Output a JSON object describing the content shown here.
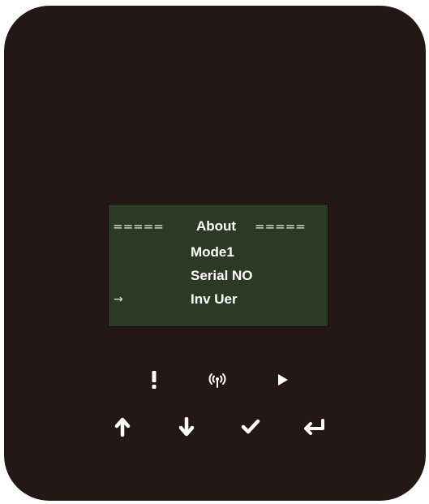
{
  "lcd": {
    "header": {
      "left_rule": "=====",
      "title": "About",
      "right_rule": "====="
    },
    "menu": [
      {
        "label": "Mode1",
        "selected": false
      },
      {
        "label": "Serial NO",
        "selected": false
      },
      {
        "label": "Inv Uer",
        "selected": true
      }
    ],
    "cursor_glyph": "→"
  },
  "indicators": [
    {
      "icon": "exclamation-icon"
    },
    {
      "icon": "wireless-icon"
    },
    {
      "icon": "play-icon"
    }
  ],
  "keys": [
    {
      "icon": "arrow-up-icon"
    },
    {
      "icon": "arrow-down-icon"
    },
    {
      "icon": "checkmark-icon"
    },
    {
      "icon": "enter-return-icon"
    }
  ],
  "colors": {
    "body": "#231815",
    "lcd_background": "#2c3a25",
    "foreground": "#ffffff"
  }
}
